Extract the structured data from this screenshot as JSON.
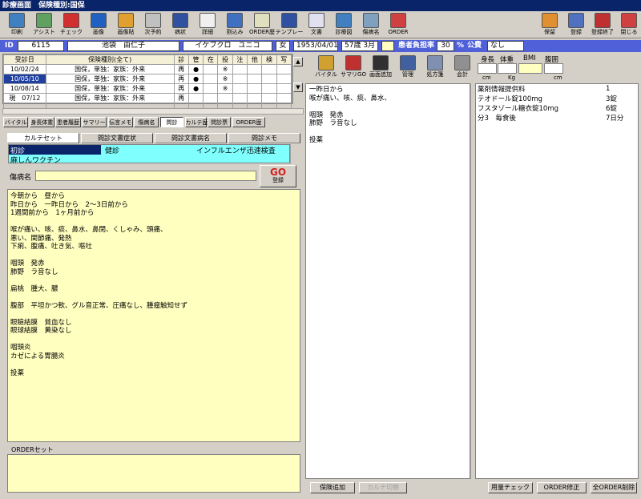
{
  "window_title": "診療画面　保険種別:国保",
  "toolbar": {
    "left": [
      {
        "label": "印刷",
        "icon": "printer-icon",
        "color": "#4080c0"
      },
      {
        "label": "アシスト",
        "icon": "assist-icon",
        "color": "#60a060"
      },
      {
        "label": "チェック",
        "icon": "check-icon",
        "color": "#d03030"
      },
      {
        "label": "画像",
        "icon": "image-icon",
        "color": "#2060c0"
      },
      {
        "label": "画像貼",
        "icon": "paste-image-icon",
        "color": "#e0a030"
      },
      {
        "label": "次予約",
        "icon": "clock-icon",
        "color": "#c0c0c0"
      },
      {
        "label": "病状",
        "icon": "doctor-icon",
        "color": "#3050a0"
      },
      {
        "label": "詳細",
        "icon": "document-icon",
        "color": "#f0f0f0"
      },
      {
        "label": "割込み",
        "icon": "interrupt-icon",
        "color": "#4070c0"
      },
      {
        "label": "ORDER歴",
        "icon": "order-history-icon",
        "color": "#e0e0c0"
      },
      {
        "label": "テンプレー",
        "icon": "template-icon",
        "color": "#3050a0"
      },
      {
        "label": "文書",
        "icon": "calculator-icon",
        "color": "#e0e0f0"
      },
      {
        "label": "診療図",
        "icon": "body-chart-icon",
        "color": "#4080c0"
      },
      {
        "label": "傷病名",
        "icon": "nurse-icon",
        "color": "#80a0c0"
      },
      {
        "label": "ORDER",
        "icon": "pill-icon",
        "color": "#d04040"
      }
    ],
    "right": [
      {
        "label": "保留",
        "icon": "hold-icon",
        "color": "#e09030"
      },
      {
        "label": "登録",
        "icon": "register-icon",
        "color": "#5070c0"
      },
      {
        "label": "登録終了",
        "icon": "register-exit-icon",
        "color": "#c03030"
      },
      {
        "label": "閉じる",
        "icon": "close-door-icon",
        "color": "#d04040"
      }
    ]
  },
  "patient": {
    "id_label": "ID",
    "id": "6115",
    "name": "池袋　由仁子",
    "kana": "イケブクロ　ユニコ",
    "sex": "女",
    "birth": "1953/04/01",
    "age": "57歳 3月",
    "burden_label": "患者負担率",
    "burden": "30",
    "pct": "%",
    "public_label": "公費",
    "public": "なし"
  },
  "history": {
    "headers": [
      "受診日",
      "保険種別(全て)",
      "診",
      "管",
      "在",
      "投",
      "注",
      "他",
      "検",
      "写"
    ],
    "rows": [
      {
        "date": "10/02/24",
        "ins": "国保，単独：家族：外来",
        "c1": "再",
        "c2": "●",
        "c3": "",
        "c4": "※",
        "c5": "",
        "c6": "",
        "c7": "",
        "c8": ""
      },
      {
        "date": "10/05/10",
        "ins": "国保，単独：家族：外来",
        "c1": "再",
        "c2": "●",
        "c3": "",
        "c4": "※",
        "c5": "",
        "c6": "",
        "c7": "",
        "c8": ""
      },
      {
        "date": "10/08/14",
        "ins": "国保，単独：家族：外来",
        "c1": "再",
        "c2": "●",
        "c3": "",
        "c4": "※",
        "c5": "",
        "c6": "",
        "c7": "",
        "c8": ""
      },
      {
        "date": "現　07/12",
        "ins": "国保，単独：家族：外来",
        "c1": "再",
        "c2": "",
        "c3": "",
        "c4": "",
        "c5": "",
        "c6": "",
        "c7": "",
        "c8": ""
      }
    ]
  },
  "mini_buttons": [
    "バイタル",
    "身長体重",
    "患者履歴",
    "サマリー",
    "伝言メモ",
    "傷病名",
    "問診",
    "カルテ歴",
    "問診票",
    "ORDER歴"
  ],
  "tabs": [
    "カルテセット",
    "問診文書症状",
    "問診文書病名",
    "問診メモ"
  ],
  "set_list": [
    {
      "a": "初診",
      "b": "健診",
      "c": "インフルエンザ迅速検査"
    },
    {
      "a": "麻しんワクチン",
      "b": "",
      "c": ""
    }
  ],
  "disease_label": "傷病名",
  "go_label": "GO",
  "register_label": "登録",
  "karte_text": "今朝から　昼から\n昨日から　一昨日から　2～3日前から\n1週間前から　1ヶ月前から\n\n喉が痛い、咳、痰、鼻水、鼻閉、くしゃみ、頭痛、\n悪い、関節痛、発熱\n下痢、腹痛、吐き気、嘔吐\n\n咽頭　発赤\n肺野　ラ音なし\n\n扁桃　腫大、膿\n\n腹部　平坦かつ軟、グル音正常、圧痛なし、腫瘤触知せず\n\n眼瞼結膜　貧血なし\n眼球結膜　黄染なし\n\n咽頭炎\nカゼによる胃腸炎\n\n投薬",
  "order_set_label": "ORDERセット",
  "mid_toolbar": [
    {
      "label": "バイタル",
      "icon": "brush-icon",
      "color": "#d0a030"
    },
    {
      "label": "サマリGO",
      "icon": "summary-go-icon",
      "color": "#c03030"
    },
    {
      "label": "画面追加",
      "icon": "add-screen-icon",
      "color": "#303030"
    },
    {
      "label": "管理",
      "icon": "manage-icon",
      "color": "#4060a0"
    },
    {
      "label": "処方箋",
      "icon": "prescription-printer-icon",
      "color": "#8090b0"
    },
    {
      "label": "会計",
      "icon": "accounting-icon",
      "color": "#909090"
    }
  ],
  "vitals": {
    "height_label": "身長",
    "weight_label": "体重",
    "bmi_label": "BMI",
    "waist_label": "腹囲",
    "cm1": "cm",
    "kg": "Kg",
    "cm2": "cm"
  },
  "today_text": "一昨日から\n喉が痛い、咳、痰、鼻水、\n\n咽頭　発赤\n肺野　ラ音なし\n\n投薬",
  "rx": [
    {
      "name": "薬剤情報提供料",
      "qty": "1"
    },
    {
      "name": "テオドール錠100mg",
      "qty": "3錠"
    },
    {
      "name": "フスタゾール糖衣錠10mg",
      "qty": "6錠"
    },
    {
      "name": "分3　毎食後",
      "qty": "7日分"
    }
  ],
  "bottom": {
    "ins_add": "保険追加",
    "karte_switch": "カルテ切替",
    "dose_check": "用量チェック",
    "order_fix": "ORDER修正",
    "order_del": "全ORDER削除"
  }
}
